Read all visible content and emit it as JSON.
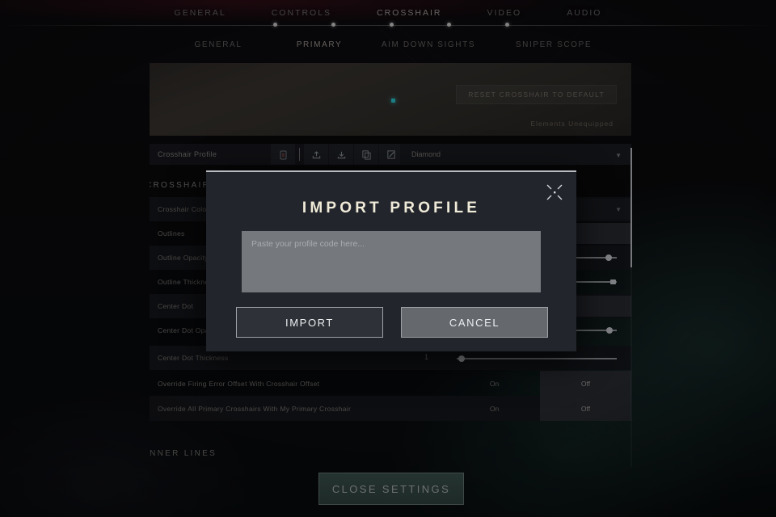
{
  "colors": {
    "accent_teal": "#44605a",
    "modal_bg": "#22262c",
    "crosshair_cyan": "#2ed8e0",
    "title_cream": "#f0ead8"
  },
  "topnav": {
    "tabs": [
      {
        "label": "GENERAL",
        "active": false
      },
      {
        "label": "CONTROLS",
        "active": false
      },
      {
        "label": "CROSSHAIR",
        "active": true
      },
      {
        "label": "VIDEO",
        "active": false
      },
      {
        "label": "AUDIO",
        "active": false
      }
    ]
  },
  "subnav": {
    "tabs": [
      {
        "label": "GENERAL",
        "active": false
      },
      {
        "label": "PRIMARY",
        "active": true
      },
      {
        "label": "AIM DOWN SIGHTS",
        "active": false
      },
      {
        "label": "SNIPER SCOPE",
        "active": false
      }
    ]
  },
  "preview": {
    "reset_button": "RESET CROSSHAIR TO DEFAULT",
    "note": "Elements Unequipped"
  },
  "profile_row": {
    "label": "Crosshair Profile",
    "selected": "Diamond",
    "chevron": "chevron-down-icon",
    "tools": [
      {
        "name": "delete-icon"
      },
      {
        "name": "export-icon"
      },
      {
        "name": "import-icon"
      },
      {
        "name": "duplicate-icon"
      },
      {
        "name": "rename-icon"
      }
    ]
  },
  "sections": [
    {
      "title": "CROSSHAIR"
    },
    {
      "title": "INNER LINES"
    }
  ],
  "settings_rows": [
    {
      "label": "Crosshair Color",
      "control": "dropdown"
    },
    {
      "label": "Outlines",
      "control": "box"
    },
    {
      "label": "Outline Opacity",
      "control": "slider",
      "value_pct": 88
    },
    {
      "label": "Outline Thickness",
      "control": "slider",
      "value_pct": 100
    },
    {
      "label": "Center Dot",
      "control": "box"
    },
    {
      "label": "Center Dot Opacity",
      "control": "slider",
      "value_pct": 92
    },
    {
      "label": "Center Dot Thickness",
      "control": "slider",
      "value_pct": 5,
      "tick": "1"
    }
  ],
  "toggle_rows": [
    {
      "label": "Override Firing Error Offset With Crosshair Offset",
      "on": "On",
      "off": "Off",
      "selected": "Off"
    },
    {
      "label": "Override All Primary Crosshairs With My Primary Crosshair",
      "on": "On",
      "off": "Off",
      "selected": "Off"
    }
  ],
  "footer": {
    "close_settings": "CLOSE SETTINGS"
  },
  "modal": {
    "title": "IMPORT PROFILE",
    "close_icon": "crosshair-close-icon",
    "textarea_value": "",
    "textarea_placeholder": "Paste your profile code here...",
    "import_button": "IMPORT",
    "cancel_button": "CANCEL"
  }
}
